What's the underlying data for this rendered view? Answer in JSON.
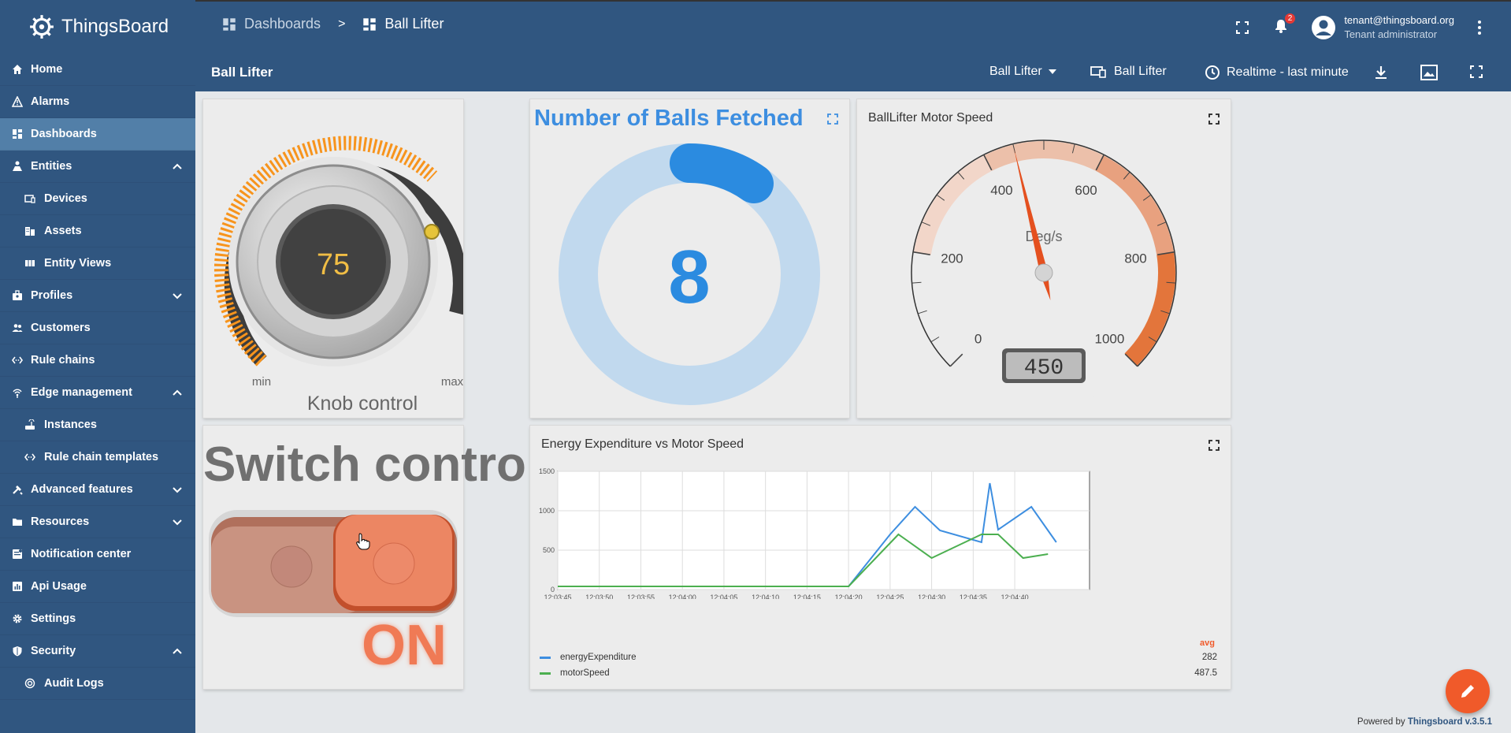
{
  "app": {
    "brand": "ThingsBoard"
  },
  "sidebar": {
    "items": [
      {
        "label": "Home"
      },
      {
        "label": "Alarms"
      },
      {
        "label": "Dashboards"
      },
      {
        "label": "Entities"
      },
      {
        "label": "Devices"
      },
      {
        "label": "Assets"
      },
      {
        "label": "Entity Views"
      },
      {
        "label": "Profiles"
      },
      {
        "label": "Customers"
      },
      {
        "label": "Rule chains"
      },
      {
        "label": "Edge management"
      },
      {
        "label": "Instances"
      },
      {
        "label": "Rule chain templates"
      },
      {
        "label": "Advanced features"
      },
      {
        "label": "Resources"
      },
      {
        "label": "Notification center"
      },
      {
        "label": "Api Usage"
      },
      {
        "label": "Settings"
      },
      {
        "label": "Security"
      },
      {
        "label": "Audit Logs"
      }
    ]
  },
  "breadcrumb": {
    "root": "Dashboards",
    "separator": ">",
    "current": "Ball Lifter"
  },
  "header": {
    "notifications_count": "2",
    "user_email": "tenant@thingsboard.org",
    "user_role": "Tenant administrator"
  },
  "toolbar": {
    "title": "Ball Lifter",
    "state_select": "Ball Lifter",
    "entity_label": "Ball Lifter",
    "timewindow": "Realtime - last minute"
  },
  "knob": {
    "value": "75",
    "min_label": "min",
    "max_label": "max",
    "title": "Knob control",
    "level": 0.75
  },
  "balls": {
    "title": "Number of Balls Fetched",
    "value": "8"
  },
  "speed": {
    "title": "BallLifter Motor Speed",
    "units": "Deg/s",
    "value": 450,
    "display": "450",
    "ticks": [
      "0",
      "200",
      "400",
      "600",
      "800",
      "1000"
    ]
  },
  "switch": {
    "title": "Switch control",
    "state": "ON"
  },
  "energy": {
    "title": "Energy Expenditure vs Motor Speed",
    "avg_header": "avg",
    "legend": [
      {
        "name": "energyExpenditure",
        "avg": "282",
        "color": "#3d8ee0"
      },
      {
        "name": "motorSpeed",
        "avg": "487.5",
        "color": "#4caf50"
      }
    ]
  },
  "chart_data": {
    "type": "line",
    "title": "Energy Expenditure vs Motor Speed",
    "xticks": [
      "12:03:45",
      "12:03:50",
      "12:03:55",
      "12:04:00",
      "12:04:05",
      "12:04:10",
      "12:04:15",
      "12:04:20",
      "12:04:25",
      "12:04:30",
      "12:04:35",
      "12:04:40"
    ],
    "yticks": [
      "0",
      "500",
      "1000",
      "1500"
    ],
    "ylim": [
      0,
      1500
    ],
    "xlim": [
      "12:03:45",
      "12:04:49"
    ],
    "series": [
      {
        "name": "energyExpenditure",
        "color": "#3d8ee0",
        "points": [
          [
            "12:03:45",
            40
          ],
          [
            "12:04:20",
            40
          ],
          [
            "12:04:25",
            700
          ],
          [
            "12:04:28",
            1050
          ],
          [
            "12:04:31",
            750
          ],
          [
            "12:04:36",
            600
          ],
          [
            "12:04:37",
            1350
          ],
          [
            "12:04:38",
            760
          ],
          [
            "12:04:42",
            1050
          ],
          [
            "12:04:45",
            600
          ]
        ]
      },
      {
        "name": "motorSpeed",
        "color": "#4caf50",
        "points": [
          [
            "12:03:45",
            40
          ],
          [
            "12:04:20",
            40
          ],
          [
            "12:04:26",
            700
          ],
          [
            "12:04:30",
            400
          ],
          [
            "12:04:34",
            600
          ],
          [
            "12:04:36",
            700
          ],
          [
            "12:04:38",
            700
          ],
          [
            "12:04:41",
            400
          ],
          [
            "12:04:44",
            450
          ]
        ]
      }
    ],
    "grid": true,
    "legend_position": "bottom"
  },
  "footer": {
    "powered_prefix": "Powered by",
    "powered_link": "Thingsboard v.3.5.1"
  },
  "colors": {
    "primary": "#305680",
    "accent": "#f05a2a",
    "active_nav": "#527fa8"
  }
}
